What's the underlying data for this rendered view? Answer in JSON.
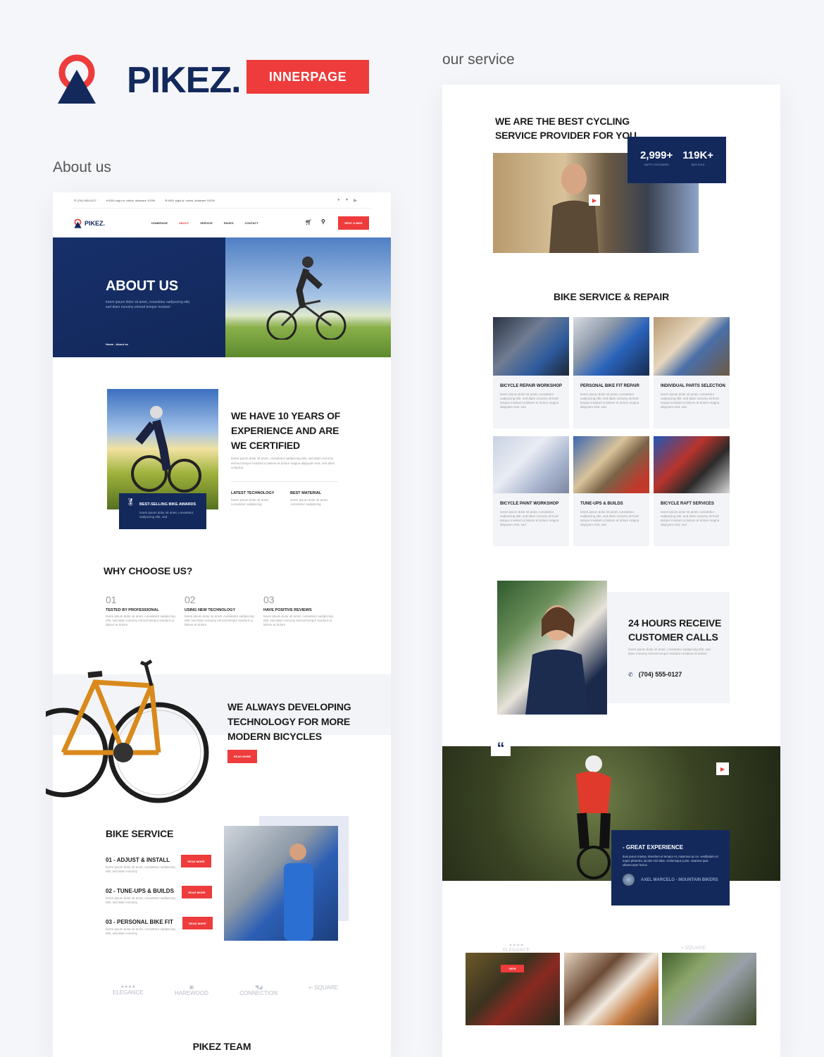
{
  "brand": {
    "name": "PIKEZ.",
    "badge": "INNERPAGE",
    "colors": {
      "navy": "#13295c",
      "red": "#ee3b3b",
      "bg": "#f5f6f9"
    }
  },
  "labels": {
    "left": "About us",
    "right": "our service"
  },
  "about": {
    "topbar": {
      "phone": "(704) 555-0127",
      "address": "6391 elgin st. celina, delaware 10299",
      "email": "6391 elgin st. celina, delaware 10299",
      "social": [
        "facebook-icon",
        "twitter-icon",
        "youtube-icon"
      ]
    },
    "nav": {
      "logo": "PIKEZ.",
      "items": [
        "HOMEPAGE",
        "ABOUT",
        "SERVICE",
        "PAGES",
        "CONTACT"
      ],
      "active": "ABOUT",
      "cta": "RENT A BIKE"
    },
    "hero": {
      "title": "ABOUT US",
      "text": "lorem ipsum dolor sit amet, consetetur sadipscing elitr, sed diam nonumy eirmod tempor invidunt",
      "breadcrumb": "Home - About us"
    },
    "experience": {
      "title_lines": [
        "WE HAVE 10 YEARS OF",
        "EXPERIENCE AND ARE",
        "WE CERTIFIED"
      ],
      "text": "lorem ipsum dolor sit amet, consetetur sadipscing elitr, sed diam nonumy eirmod tempor invidunt ut labore et dolore magna aliquyam erat, sed diam voluptua.",
      "award_title": "BEST-SELLING BIKE AWARDS",
      "award_text": "lorem ipsum dolor sit amet, consetetur sadipscing elitr, sed",
      "features": [
        {
          "title": "LATEST TECHNOLOGY",
          "text": "lorem ipsum dolor sit amet, consetetur sadipscing"
        },
        {
          "title": "BEST MATERIAL",
          "text": "lorem ipsum dolor sit amet, consetetur sadipscing"
        }
      ]
    },
    "why": {
      "title": "WHY CHOOSE US?",
      "items": [
        {
          "num": "01",
          "title": "TESTED BY PROFESSIONAL",
          "text": "lorem ipsum dolor sit amet, consetetur sadipscing elitr, sed diam nonumy eirmod tempor invidunt ut labore et dolore"
        },
        {
          "num": "02",
          "title": "USING NEW TECHNOLOGY",
          "text": "lorem ipsum dolor sit amet, consetetur sadipscing elitr, sed diam nonumy eirmod tempor invidunt ut labore et dolore"
        },
        {
          "num": "03",
          "title": "HAVE POSITIVE REVIEWS",
          "text": "lorem ipsum dolor sit amet, consetetur sadipscing elitr, sed diam nonumy eirmod tempor invidunt ut labore et dolore"
        }
      ]
    },
    "developing": {
      "title_lines": [
        "WE ALWAYS DEVELOPING",
        "TECHNOLOGY FOR MORE",
        "MODERN BICYCLES"
      ],
      "button": "READ MORE"
    },
    "bike_service": {
      "title": "BIKE SERVICE",
      "items": [
        {
          "title": "01 - ADJUST & INSTALL",
          "text": "lorem ipsum dolor sit amet, consetetur sadipscing elitr, sed diam nonumy",
          "button": "READ MORE"
        },
        {
          "title": "02 - TUNE-UPS & BUILDS",
          "text": "lorem ipsum dolor sit amet, consetetur sadipscing elitr, sed diam nonumy",
          "button": "READ MORE"
        },
        {
          "title": "03 - PERSONAL BIKE FIT",
          "text": "lorem ipsum dolor sit amet, consetetur sadipscing elitr, sed diam nonumy",
          "button": "READ MORE"
        }
      ]
    },
    "partners": [
      "ELEGANCE",
      "HAREWOOD",
      "CONNECTION",
      "SQUARE"
    ],
    "team_title": "PIKEZ TEAM"
  },
  "service": {
    "intro": {
      "title_lines": [
        "WE ARE THE BEST CYCLING",
        "SERVICE PROVIDER FOR YOU"
      ],
      "stats": [
        {
          "value": "2,999+",
          "label": "HAPPY COSTUMERS"
        },
        {
          "value": "119K+",
          "label": "BIKE SOLD"
        }
      ]
    },
    "repair": {
      "title": "BIKE SERVICE & REPAIR",
      "cards": [
        {
          "title": "BICYCLE REPAIR WORKSHOP",
          "text": "lorem ipsum dolor sit amet, consetetur sadipscing elitr, sed diam nonumy eirmod tempor invidunt ut labore et dolore magna aliquyam erat, sed"
        },
        {
          "title": "PERSONAL BIKE FIT REPAIR",
          "text": "lorem ipsum dolor sit amet, consetetur sadipscing elitr, sed diam nonumy eirmod tempor invidunt ut labore et dolore magna aliquyam erat, sed"
        },
        {
          "title": "INDIVIDUAL PARTS SELECTION",
          "text": "lorem ipsum dolor sit amet, consetetur sadipscing elitr, sed diam nonumy eirmod tempor invidunt ut labore et dolore magna aliquyam erat, sed"
        },
        {
          "title": "BICYCLE PAINT WORKSHOP",
          "text": "lorem ipsum dolor sit amet, consetetur sadipscing elitr, sed diam nonumy eirmod tempor invidunt ut labore et dolore magna aliquyam erat, sed"
        },
        {
          "title": "TUNE-UPS & BUILDS",
          "text": "lorem ipsum dolor sit amet, consetetur sadipscing elitr, sed diam nonumy eirmod tempor invidunt ut labore et dolore magna aliquyam erat, sed"
        },
        {
          "title": "BICYCLE RAFT SERVICES",
          "text": "lorem ipsum dolor sit amet, consetetur sadipscing elitr, sed diam nonumy eirmod tempor invidunt ut labore et dolore magna aliquyam erat, sed"
        }
      ]
    },
    "calls": {
      "title_lines": [
        "24 HOURS RECEIVE",
        "CUSTOMER CALLS"
      ],
      "text": "lorem ipsum dolor sit amet, consetetur sadipscing elitr, sed diam nonumy eirmod tempor invidunt ut labore et dolore",
      "phone": "(704) 555-0127"
    },
    "testimonial": {
      "title": "- GREAT EXPERIENCE",
      "text": "duis purus massa, interdum et tempor et, maximus ac ex. vestibulum et turpis pharetra, iaculis nisl vitae, scelerisque justo. vivamus quis ullamcorper lectus",
      "author": "AXEL MARCELO - MOUNTAIN BIKERS"
    },
    "partners": [
      "ELEGANCE",
      "SQUARE"
    ],
    "gallery_button": "VIEW"
  }
}
